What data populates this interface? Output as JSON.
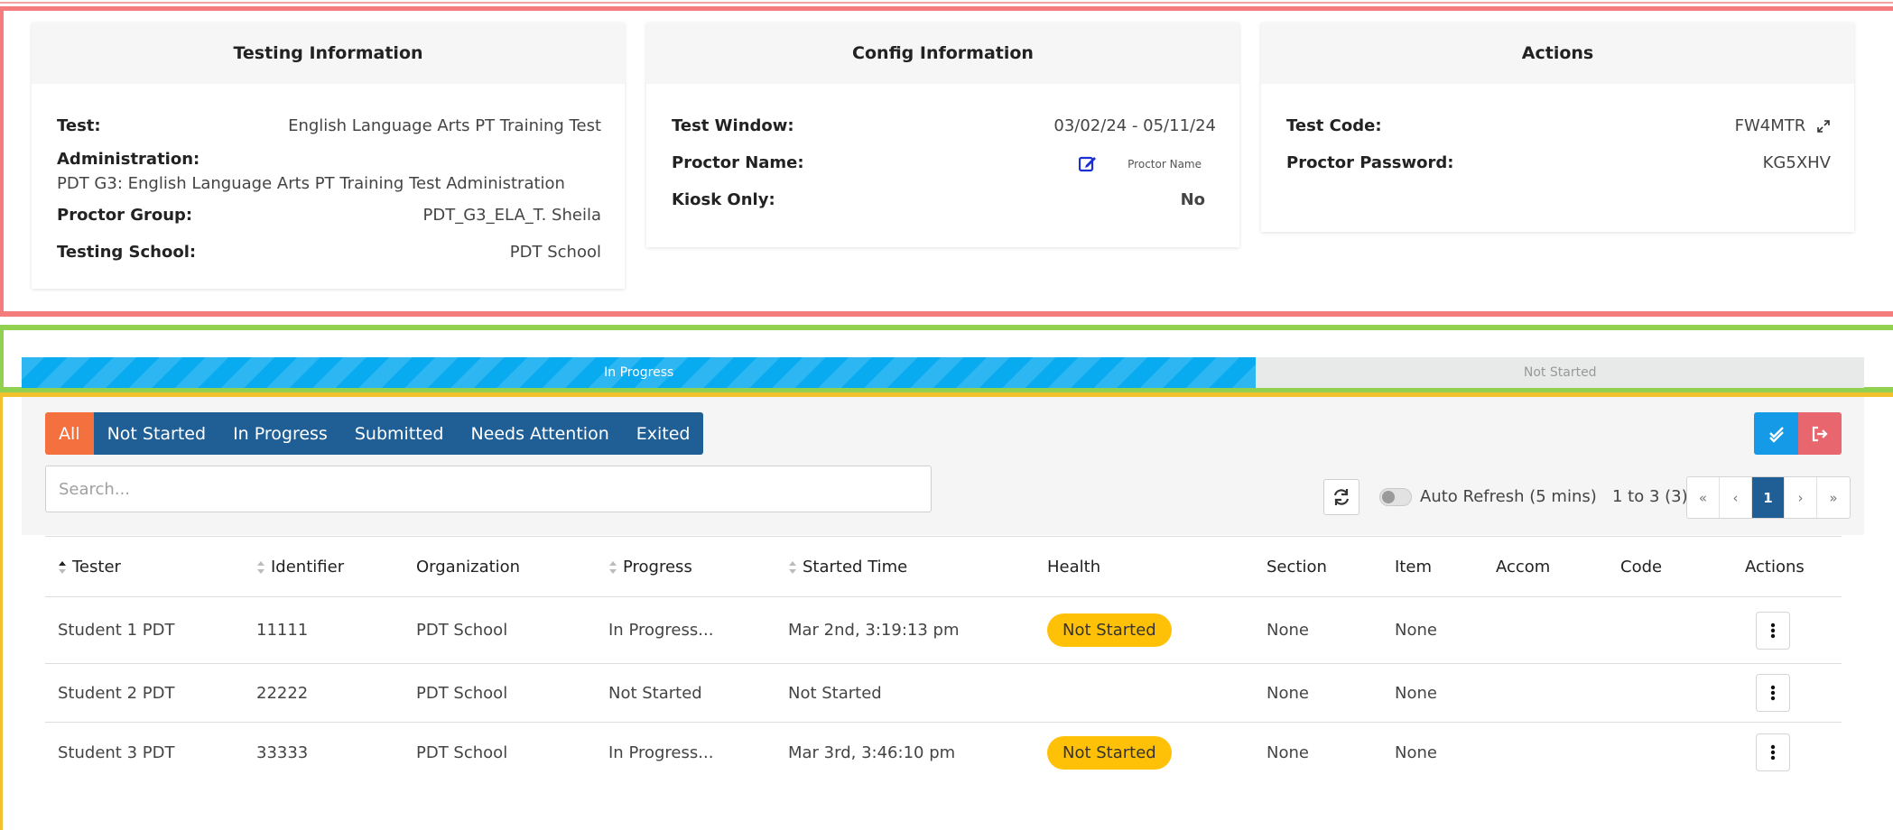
{
  "testing_info": {
    "title": "Testing Information",
    "test_label": "Test:",
    "test_value": "English Language Arts PT Training Test",
    "administration_label": "Administration:",
    "administration_value": "PDT G3: English Language Arts PT Training Test Administration",
    "proctor_group_label": "Proctor Group:",
    "proctor_group_value": "PDT_G3_ELA_T. Sheila",
    "testing_school_label": "Testing School:",
    "testing_school_value": "PDT School"
  },
  "config_info": {
    "title": "Config Information",
    "test_window_label": "Test Window:",
    "test_window_value": "03/02/24 - 05/11/24",
    "proctor_name_label": "Proctor Name:",
    "proctor_name_value": "Proctor Name",
    "kiosk_label": "Kiosk Only:",
    "kiosk_value": "No"
  },
  "actions_card": {
    "title": "Actions",
    "test_code_label": "Test Code:",
    "test_code_value": "FW4MTR",
    "proctor_password_label": "Proctor Password:",
    "proctor_password_value": "KG5XHV"
  },
  "progress_bar": {
    "in_progress_label": "In Progress",
    "not_started_label": "Not Started",
    "in_progress_fraction": 0.67
  },
  "filters": {
    "items": [
      "All",
      "Not Started",
      "In Progress",
      "Submitted",
      "Needs Attention",
      "Exited"
    ],
    "active": "All"
  },
  "search": {
    "placeholder": "Search..."
  },
  "auto_refresh_label": "Auto Refresh (5 mins)",
  "range_text": "1 to 3 (3)",
  "pager": {
    "first": "«",
    "prev": "‹",
    "current": "1",
    "next": "›",
    "last": "»"
  },
  "table": {
    "columns": [
      "Tester",
      "Identifier",
      "Organization",
      "Progress",
      "Started Time",
      "Health",
      "Section",
      "Item",
      "Accom",
      "Code",
      "Actions"
    ],
    "rows": [
      {
        "tester": "Student 1 PDT",
        "identifier": "11111",
        "organization": "PDT School",
        "progress": "In Progress...",
        "started": "Mar 2nd, 3:19:13 pm",
        "health": "Not Started",
        "section": "None",
        "item": "None",
        "accom": "",
        "code": ""
      },
      {
        "tester": "Student 2 PDT",
        "identifier": "22222",
        "organization": "PDT School",
        "progress": "Not Started",
        "started": "Not Started",
        "health": "",
        "section": "None",
        "item": "None",
        "accom": "",
        "code": ""
      },
      {
        "tester": "Student 3 PDT",
        "identifier": "33333",
        "organization": "PDT School",
        "progress": "In Progress...",
        "started": "Mar 3rd, 3:46:10 pm",
        "health": "Not Started",
        "section": "None",
        "item": "None",
        "accom": "",
        "code": ""
      }
    ]
  },
  "colors": {
    "filter_active": "#f4713f",
    "filter_default": "#1f5f96",
    "progress_done": "#08aaf0",
    "badge_warning": "#ffc107",
    "kiosk_no": "#e06262"
  },
  "icons": {
    "edit": "edit-icon",
    "expand": "expand-icon",
    "check_all": "double-check-icon",
    "exit": "exit-icon",
    "refresh": "refresh-icon",
    "kebab": "kebab-menu-icon",
    "sort": "sort-icon"
  }
}
